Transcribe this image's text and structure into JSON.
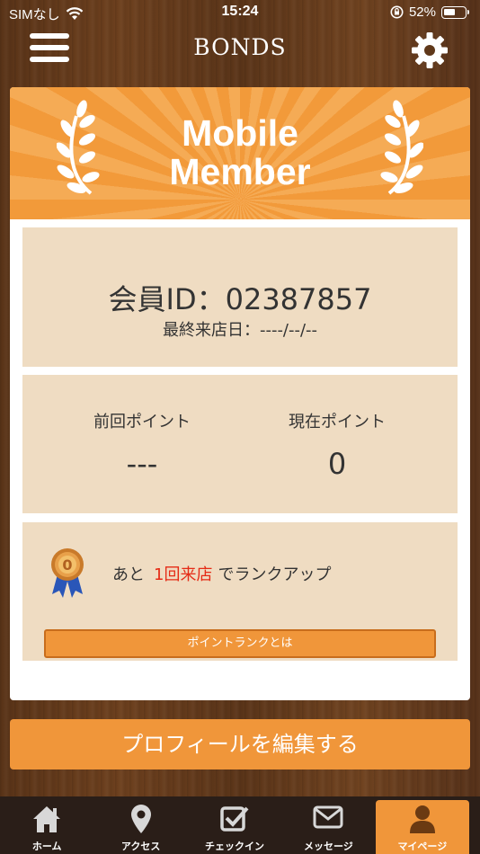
{
  "status_bar": {
    "carrier": "SIMなし",
    "time": "15:24",
    "battery_percent": "52%"
  },
  "header": {
    "logo_text": "BONDS",
    "menu_icon": "hamburger-icon",
    "settings_icon": "gear-icon"
  },
  "banner": {
    "title_line1": "Mobile",
    "title_line2": "Member"
  },
  "member": {
    "id_text": "会員ID：02387857",
    "last_visit_text": "最終来店日：----/--/--"
  },
  "points": {
    "prev_label": "前回ポイント",
    "prev_value": "---",
    "curr_label": "現在ポイント",
    "curr_value": "0"
  },
  "rank": {
    "medal_number": "0",
    "prefix": "あと",
    "highlight": "1回来店",
    "suffix": "でランクアップ",
    "button_label": "ポイントランクとは"
  },
  "profile_button_label": "プロフィールを編集する",
  "tabs": [
    {
      "label": "ホーム",
      "icon": "home-icon",
      "active": false
    },
    {
      "label": "アクセス",
      "icon": "map-pin-icon",
      "active": false
    },
    {
      "label": "チェックイン",
      "icon": "checkin-icon",
      "active": false
    },
    {
      "label": "メッセージ",
      "icon": "mail-icon",
      "active": false
    },
    {
      "label": "マイページ",
      "icon": "user-icon",
      "active": true
    }
  ],
  "colors": {
    "accent_orange": "#f0963a",
    "highlight_red": "#e52b16",
    "panel_beige": "#efdcc2",
    "tab_bar": "#2a1e18"
  }
}
